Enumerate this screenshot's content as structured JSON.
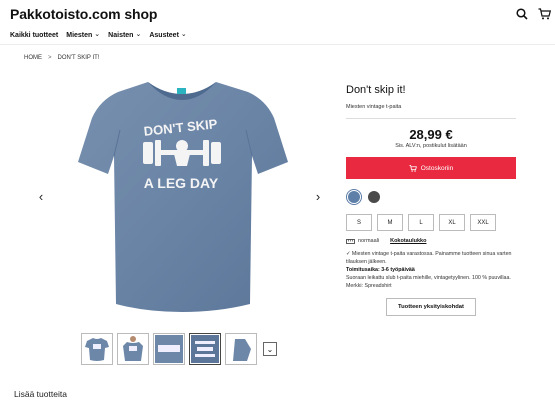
{
  "header": {
    "brand": "Pakkotoisto.com shop",
    "icons": [
      "search-icon",
      "cart-icon"
    ]
  },
  "nav": {
    "items": [
      {
        "label": "Kaikki tuotteet",
        "has_chevron": false
      },
      {
        "label": "Miesten",
        "has_chevron": true
      },
      {
        "label": "Naisten",
        "has_chevron": true
      },
      {
        "label": "Asusteet",
        "has_chevron": true
      }
    ]
  },
  "breadcrumb": {
    "home": "HOME",
    "separator": ">",
    "current": "DON'T SKIP IT!"
  },
  "gallery": {
    "print_line1": "DON'T SKIP",
    "print_line2": "A LEG DAY",
    "thumbnail_count": 5,
    "selected_thumbnail": 4
  },
  "product": {
    "title": "Don't skip it!",
    "subtitle": "Miesten vintage t-paita",
    "price": "28,99 €",
    "tax_note": "Sis. ALV:n, postikulut lisätään",
    "cart_label": "Ostoskoriin",
    "colors": [
      {
        "name": "denim blue",
        "hex": "#5d7fa8",
        "selected": true
      },
      {
        "name": "dark grey",
        "hex": "#4a4a4a",
        "selected": false
      }
    ],
    "sizes": [
      "S",
      "M",
      "L",
      "XL",
      "XXL"
    ],
    "fit_label": "normaali",
    "size_chart_link": "Kokotaulukko",
    "stock_note": "✓ Miesten vintage t-paita varastossa. Painamme tuotteen sinua varten tilauksen jälkeen.",
    "delivery_label": "Toimitusaika: 3-6 työpäivää",
    "description": "Suoraan leikattu slub t-paita miehille, vintagetyylinen. 100 % puuvillaa. Merkki: Spreadshirt",
    "details_button": "Tuotteen yksityiskohdat"
  },
  "more_products": "Lisää tuotteita",
  "colors": {
    "accent_red": "#e8293f",
    "shirt_blue": "#6d87a8"
  }
}
